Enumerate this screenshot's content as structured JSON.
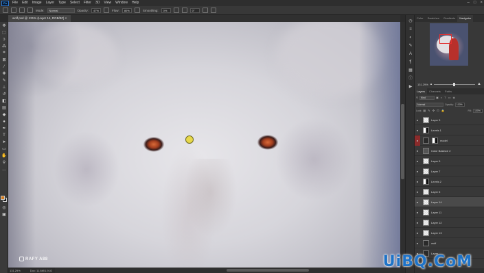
{
  "menubar": {
    "logo": "Ps",
    "items": [
      "File",
      "Edit",
      "Image",
      "Layer",
      "Type",
      "Select",
      "Filter",
      "3D",
      "View",
      "Window",
      "Help"
    ]
  },
  "options": {
    "mode_label": "Mode:",
    "mode_value": "Normal",
    "opacity_label": "Opacity:",
    "opacity_value": "47%",
    "flow_label": "Flow:",
    "flow_value": "80%",
    "smoothing_label": "Smoothing:",
    "smoothing_value": "0%",
    "angle_value": "0°"
  },
  "document": {
    "tab_label": "wolf.psd @ 131% (Layer 14, RGB/8#) ×"
  },
  "canvas": {
    "watermark": "RAFY A88"
  },
  "status": {
    "zoom": "131.29%",
    "doc": "Doc: 11.8M/1.91G"
  },
  "panels": {
    "nav_tabs": [
      "Color",
      "Swatches",
      "Gradients",
      "Navigator"
    ],
    "nav_active": "Navigator",
    "nav_zoom": "131.29%",
    "layer_tabs": [
      "Layers",
      "Channels",
      "Paths"
    ],
    "filter_label": "Kind",
    "blend_mode": "Normal",
    "opacity_label": "Opacity:",
    "opacity_value": "100%",
    "lock_label": "Lock:",
    "fill_label": "Fill:",
    "fill_value": "100%",
    "layers": [
      {
        "name": "Layer 3",
        "thumb": "transparent",
        "extra": ""
      },
      {
        "name": "Levels 1",
        "thumb": "mask",
        "extra": ""
      },
      {
        "name": "model",
        "thumb": "dark",
        "extra": ""
      },
      {
        "name": "Color Balance 2",
        "thumb": "adjust",
        "extra": ""
      },
      {
        "name": "Layer 9",
        "thumb": "transparent",
        "extra": ""
      },
      {
        "name": "Layer 7",
        "thumb": "transparent",
        "extra": ""
      },
      {
        "name": "Levels 2",
        "thumb": "mask",
        "extra": ""
      },
      {
        "name": "Layer 5",
        "thumb": "transparent",
        "extra": ""
      },
      {
        "name": "Layer 14",
        "thumb": "transparent",
        "extra": ""
      },
      {
        "name": "Layer 11",
        "thumb": "transparent",
        "extra": ""
      },
      {
        "name": "Layer 12",
        "thumb": "transparent",
        "extra": ""
      },
      {
        "name": "Layer 13",
        "thumb": "transparent",
        "extra": ""
      },
      {
        "name": "wolf",
        "thumb": "dark",
        "extra": ""
      },
      {
        "name": "Layer",
        "thumb": "dark",
        "extra": ""
      }
    ]
  },
  "site_watermark": "UiBQ.CoM"
}
